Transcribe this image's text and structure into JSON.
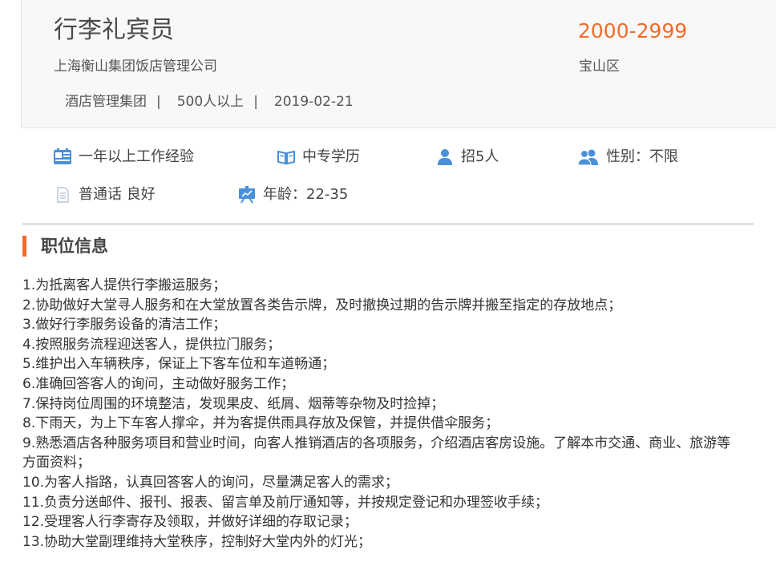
{
  "header": {
    "job_title": "行李礼宾员",
    "company": "上海衡山集团饭店管理公司",
    "meta": {
      "industry": "酒店管理集团",
      "size": "500人以上",
      "date": "2019-02-21"
    },
    "salary": "2000-2999",
    "district": "宝山区"
  },
  "requirements": {
    "experience": {
      "icon": "experience-card-icon",
      "text": "一年以上工作经验"
    },
    "education": {
      "icon": "book-icon",
      "text": "中专学历"
    },
    "headcount": {
      "icon": "person-icon",
      "text": "招5人"
    },
    "gender": {
      "icon": "two-persons-icon",
      "text": "性别：不限"
    },
    "language": {
      "icon": "document-icon",
      "text": "普通话 良好"
    },
    "age": {
      "icon": "presentation-board-icon",
      "text": "年龄：22-35"
    }
  },
  "section": {
    "title": "职位信息"
  },
  "description": [
    "1.为抵离客人提供行李搬运服务；",
    "2.协助做好大堂寻人服务和在大堂放置各类告示牌，及时撤换过期的告示牌并搬至指定的存放地点；",
    "3.做好行李服务设备的清洁工作；",
    "4.按照服务流程迎送客人，提供拉门服务；",
    "5.维护出入车辆秩序，保证上下客车位和车道畅通；",
    "6.准确回答客人的询问，主动做好服务工作；",
    "7.保持岗位周围的环境整洁，发现果皮、纸屑、烟蒂等杂物及时捡掉；",
    "8.下雨天，为上下车客人撑伞，并为客提供雨具存放及保管，并提供借伞服务；",
    "9.熟悉酒店各种服务项目和营业时间，向客人推销酒店的各项服务，介绍酒店客房设施。了解本市交通、商业、旅游等方面资料；",
    "10.为客人指路，认真回答客人的询问，尽量满足客人的需求；",
    "11.负责分送邮件、报刊、报表、留言单及前厅通知等，并按规定登记和办理签收手续；",
    "12.受理客人行李寄存及领取，并做好详细的存取记录；",
    "13.协助大堂副理维持大堂秩序，控制好大堂内外的灯光；"
  ],
  "colors": {
    "accent": "#f26b2a",
    "icon_blue": "#4a90d9",
    "icon_gray": "#b8c4d4",
    "card_bg": "#f8f8f8"
  }
}
